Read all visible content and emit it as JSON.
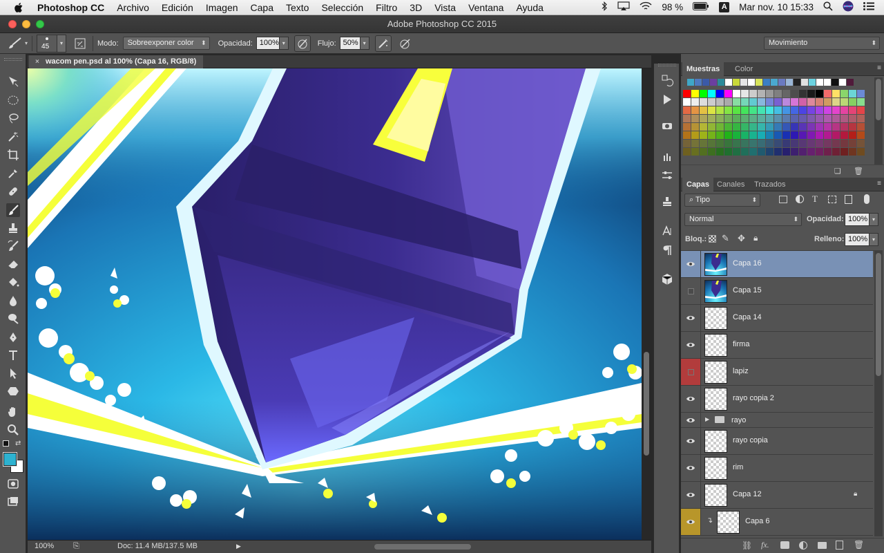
{
  "menubar": {
    "app_name": "Photoshop CC",
    "items": [
      "Archivo",
      "Edición",
      "Imagen",
      "Capa",
      "Texto",
      "Selección",
      "Filtro",
      "3D",
      "Vista",
      "Ventana",
      "Ayuda"
    ],
    "battery": "98 %",
    "input_source": "A",
    "clock": "Mar nov. 10  15:33"
  },
  "window": {
    "title": "Adobe Photoshop CC 2015"
  },
  "options": {
    "brush_size": "45",
    "mode_label": "Modo:",
    "mode_value": "Sobreexponer color",
    "opacity_label": "Opacidad:",
    "opacity_value": "100%",
    "flow_label": "Flujo:",
    "flow_value": "50%",
    "workspace": "Movimiento"
  },
  "document": {
    "tab_title": "wacom pen.psd al 100% (Capa 16, RGB/8)",
    "zoom": "100%",
    "doc_info": "Doc: 11.4 MB/137.5 MB"
  },
  "tools": {
    "foreground_color": "#2db2d0",
    "background_color": "#ffffff"
  },
  "swatches_panel": {
    "tabs": [
      "Muestras",
      "Color"
    ],
    "recent": [
      "#3fa7c8",
      "#4e7ac0",
      "#3b5aa8",
      "#6b3fa0",
      "#2a8a9a",
      "#ffffff",
      "#c9d93a",
      "#e6e6e6",
      "#ffffff",
      "#d7e45b",
      "#3b7fc4",
      "#4aa9cf",
      "#6a7ac0",
      "#9ab6d6",
      "#222222",
      "#e0e0e0",
      "#6bd2e0",
      "#ffffff",
      "#ffffff",
      "#101010",
      "#ffffff",
      "#501a3a"
    ]
  },
  "layers_panel": {
    "tabs": [
      "Capas",
      "Canales",
      "Trazados"
    ],
    "filter_label": "Tipo",
    "blend_mode": "Normal",
    "opacity_label": "Opacidad:",
    "opacity_value": "100%",
    "lock_label": "Bloq.:",
    "fill_label": "Relleno:",
    "fill_value": "100%",
    "layers": [
      {
        "name": "Capa 16",
        "visible": true,
        "selected": true,
        "thumb": "art"
      },
      {
        "name": "Capa 15",
        "visible": false,
        "selected": false,
        "thumb": "art"
      },
      {
        "name": "Capa 14",
        "visible": true,
        "selected": false,
        "thumb": "blank"
      },
      {
        "name": "firma",
        "visible": true,
        "selected": false,
        "thumb": "blank"
      },
      {
        "name": "lapiz",
        "visible": false,
        "selected": false,
        "thumb": "blank",
        "label_color": "#b23c3c"
      },
      {
        "name": "rayo copia 2",
        "visible": true,
        "selected": false,
        "thumb": "blank"
      },
      {
        "name": "rayo",
        "visible": true,
        "selected": false,
        "thumb": "folder"
      },
      {
        "name": "rayo copia",
        "visible": true,
        "selected": false,
        "thumb": "blank"
      },
      {
        "name": "rim",
        "visible": true,
        "selected": false,
        "thumb": "blank"
      },
      {
        "name": "Capa 12",
        "visible": true,
        "selected": false,
        "thumb": "blank",
        "locked": true
      },
      {
        "name": "Capa 6",
        "visible": true,
        "selected": false,
        "thumb": "blank",
        "label_color": "#b8962a",
        "clipped": true
      }
    ]
  }
}
